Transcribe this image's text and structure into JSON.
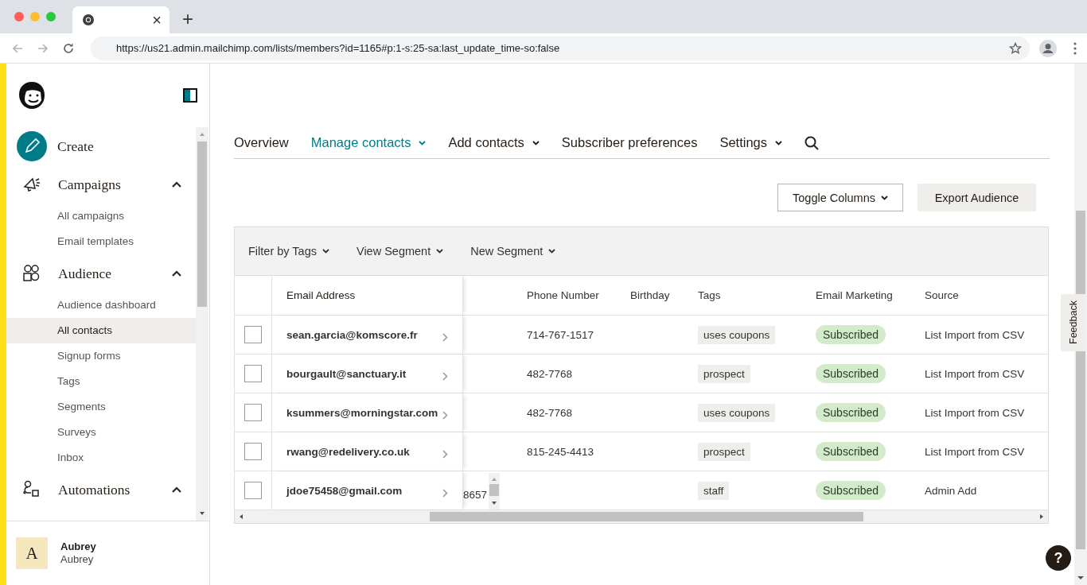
{
  "browser": {
    "tab_close": "×",
    "new_tab": "+",
    "url": "https://us21.admin.mailchimp.com/lists/members?id=1165#p:1-s:25-sa:last_update_time-so:false"
  },
  "sidebar": {
    "nav": [
      {
        "kind": "create",
        "label": "Create"
      },
      {
        "kind": "section",
        "label": "Campaigns",
        "expanded": true,
        "children": [
          {
            "label": "All campaigns",
            "selected": false
          },
          {
            "label": "Email templates",
            "selected": false
          }
        ]
      },
      {
        "kind": "section",
        "label": "Audience",
        "expanded": true,
        "children": [
          {
            "label": "Audience dashboard",
            "selected": false
          },
          {
            "label": "All contacts",
            "selected": true
          },
          {
            "label": "Signup forms",
            "selected": false
          },
          {
            "label": "Tags",
            "selected": false
          },
          {
            "label": "Segments",
            "selected": false
          },
          {
            "label": "Surveys",
            "selected": false
          },
          {
            "label": "Inbox",
            "selected": false
          }
        ]
      },
      {
        "kind": "section",
        "label": "Automations",
        "expanded": true
      }
    ],
    "user": {
      "initial": "A",
      "name": "Aubrey",
      "account": "Aubrey"
    }
  },
  "tabs": [
    {
      "label": "Overview",
      "selected": false,
      "dropdown": false
    },
    {
      "label": "Manage contacts",
      "selected": true,
      "dropdown": true
    },
    {
      "label": "Add contacts",
      "selected": false,
      "dropdown": true
    },
    {
      "label": "Subscriber preferences",
      "selected": false,
      "dropdown": false
    },
    {
      "label": "Settings",
      "selected": false,
      "dropdown": true
    }
  ],
  "actions": [
    {
      "label": "Toggle Columns",
      "kind": "dropdown"
    },
    {
      "label": "Export Audience",
      "kind": "plain"
    }
  ],
  "filters": [
    "Filter by Tags",
    "View Segment",
    "New Segment"
  ],
  "table": {
    "columns": [
      {
        "kind": "email",
        "label": "Email Address"
      },
      {
        "kind": "scroll"
      },
      {
        "kind": "text",
        "label": "Phone Number"
      },
      {
        "kind": "text",
        "label": "Birthday"
      },
      {
        "kind": "tag",
        "label": "Tags"
      },
      {
        "kind": "status",
        "label": "Email Marketing"
      },
      {
        "kind": "text",
        "label": "Source"
      }
    ],
    "rows": [
      {
        "checked": false,
        "email": "sean.garcia@komscore.fr",
        "phone": "714-767-1517",
        "tags": "uses coupons",
        "email_marketing": "Subscribed",
        "source": "List Import from CSV"
      },
      {
        "checked": false,
        "email": "bourgault@sanctuary.it",
        "phone": "482-7768",
        "tags": "prospect",
        "email_marketing": "Subscribed",
        "source": "List Import from CSV"
      },
      {
        "checked": false,
        "email": "ksummers@morningstar.com",
        "phone": "482-7768",
        "tags": "uses coupons",
        "email_marketing": "Subscribed",
        "source": "List Import from CSV"
      },
      {
        "checked": false,
        "email": "rwang@redelivery.co.uk",
        "phone": "815-245-4413",
        "tags": "prospect",
        "email_marketing": "Subscribed",
        "source": "List Import from CSV"
      },
      {
        "checked": false,
        "email": "jdoe75458@gmail.com",
        "column_3": "8657",
        "tags": "staff",
        "email_marketing": "Subscribed",
        "source": "Admin Add"
      }
    ]
  },
  "feedback": "Feedback",
  "help": "?"
}
